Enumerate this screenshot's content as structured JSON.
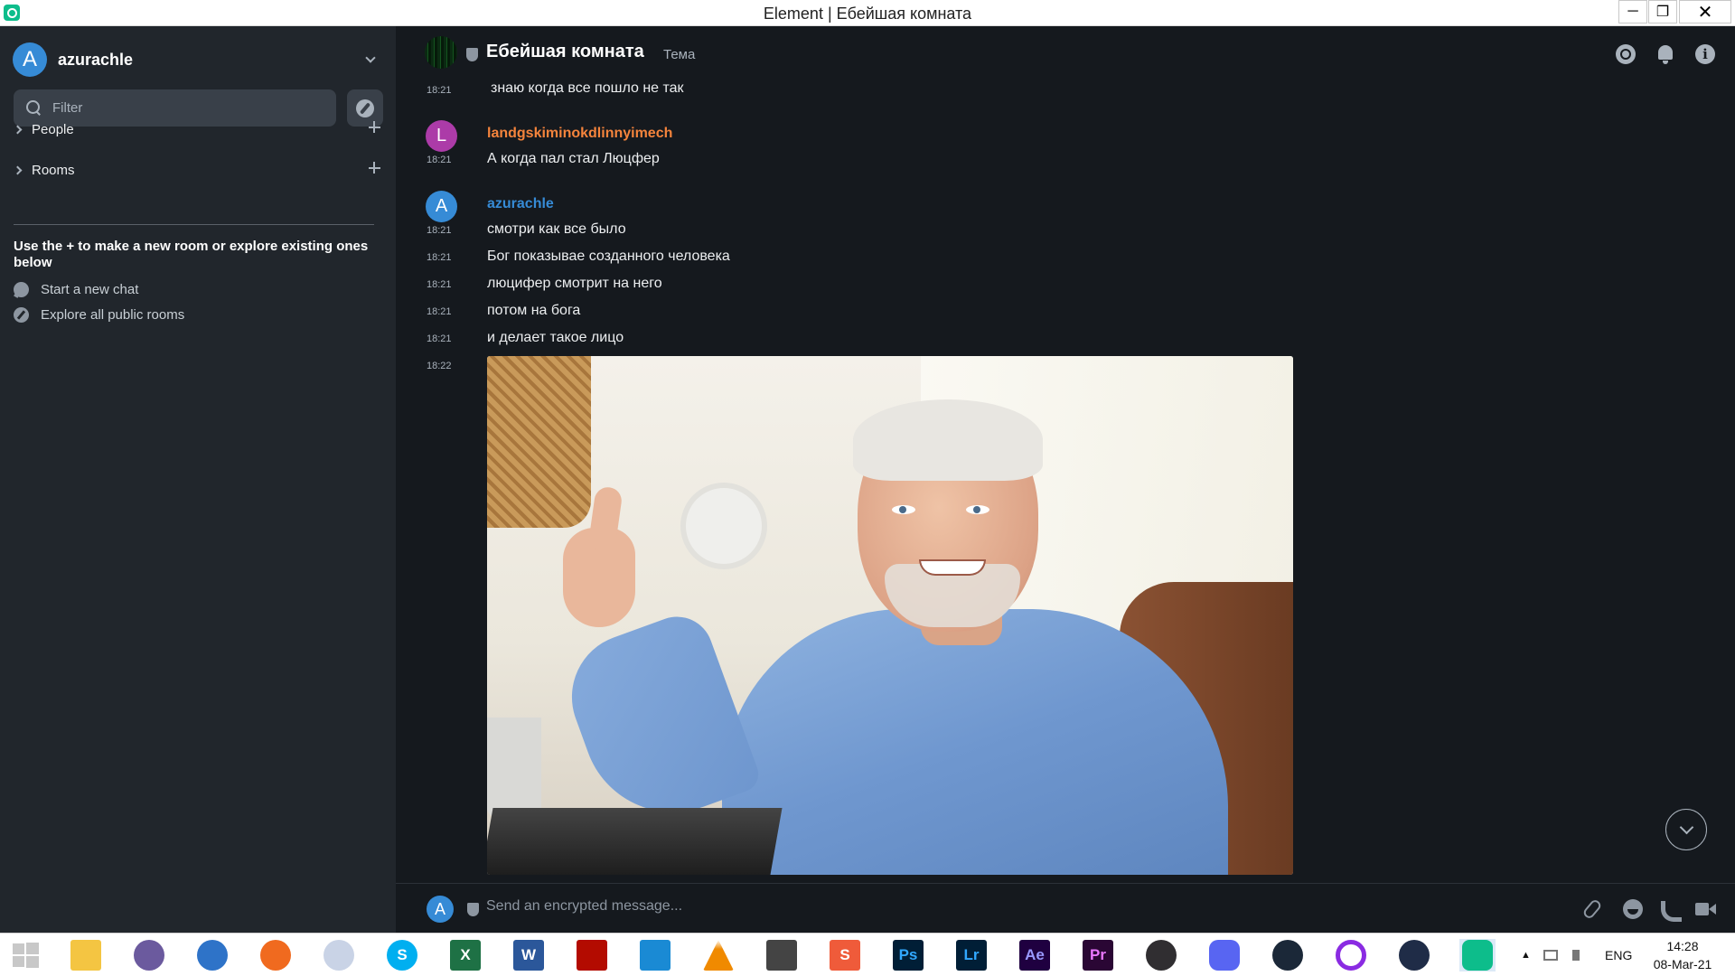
{
  "window": {
    "title": "Element | Ебейшая комната",
    "controls": {
      "minimize": "─",
      "maximize": "❐",
      "close": "✕"
    }
  },
  "sidebar": {
    "user": {
      "initial": "A",
      "name": "azurachle"
    },
    "filter_placeholder": "Filter",
    "sections": [
      {
        "label": "People"
      },
      {
        "label": "Rooms"
      }
    ],
    "hint": "Use the + to make a new room or explore existing ones below",
    "links": [
      {
        "label": "Start a new chat",
        "icon": "chat-bubble-icon"
      },
      {
        "label": "Explore all public rooms",
        "icon": "compass-icon"
      }
    ]
  },
  "room": {
    "name": "Ебейшая комната",
    "topic": "Тема"
  },
  "timeline": {
    "messages": [
      {
        "time": "18:21",
        "text": "знаю когда все пошло не так"
      },
      {
        "sender": "landgskiminokdlinnyimech",
        "sender_initial": "L",
        "sender_color": "#ac3ba8",
        "time": "18:21",
        "text": "А когда пал стал Люцфер"
      },
      {
        "sender": "azurachle",
        "sender_initial": "A",
        "sender_color": "#368bd6",
        "time": "18:21",
        "text": "смотри как все было"
      },
      {
        "time": "18:21",
        "text": "Бог показывае созданного человека"
      },
      {
        "time": "18:21",
        "text": "люцифер смотрит на него"
      },
      {
        "time": "18:21",
        "text": "потом на бога"
      },
      {
        "time": "18:21",
        "text": "и делает такое лицо"
      },
      {
        "time": "18:22",
        "image": "smiling-elderly-man-thumbs-up-photo"
      }
    ]
  },
  "composer": {
    "avatar_initial": "A",
    "placeholder": "Send an encrypted message..."
  },
  "taskbar": {
    "apps": [
      {
        "name": "start",
        "glyph": ""
      },
      {
        "name": "file-explorer",
        "glyph": ""
      },
      {
        "name": "torrent",
        "glyph": ""
      },
      {
        "name": "browser",
        "glyph": ""
      },
      {
        "name": "firefox",
        "glyph": ""
      },
      {
        "name": "app",
        "glyph": ""
      },
      {
        "name": "skype",
        "glyph": "S"
      },
      {
        "name": "excel",
        "glyph": "X"
      },
      {
        "name": "word",
        "glyph": "W"
      },
      {
        "name": "acrobat",
        "glyph": ""
      },
      {
        "name": "vscode",
        "glyph": ""
      },
      {
        "name": "vlc",
        "glyph": ""
      },
      {
        "name": "downloader",
        "glyph": ""
      },
      {
        "name": "sublime",
        "glyph": "S"
      },
      {
        "name": "photoshop",
        "glyph": "Ps"
      },
      {
        "name": "lightroom",
        "glyph": "Lr"
      },
      {
        "name": "after-effects",
        "glyph": "Ae"
      },
      {
        "name": "premiere",
        "glyph": "Pr"
      },
      {
        "name": "obs",
        "glyph": ""
      },
      {
        "name": "discord",
        "glyph": ""
      },
      {
        "name": "steam",
        "glyph": ""
      },
      {
        "name": "circle-app",
        "glyph": ""
      },
      {
        "name": "vpn",
        "glyph": ""
      },
      {
        "name": "element",
        "glyph": ""
      }
    ],
    "tray": {
      "lang": "ENG",
      "time": "14:28",
      "date": "08-Mar-21"
    }
  },
  "colors": {
    "accent": "#0dbd8b",
    "sidebar_bg": "#21262c",
    "timeline_bg": "#15191e",
    "sender_orange": "#f5843c",
    "sender_blue": "#368bd6"
  }
}
